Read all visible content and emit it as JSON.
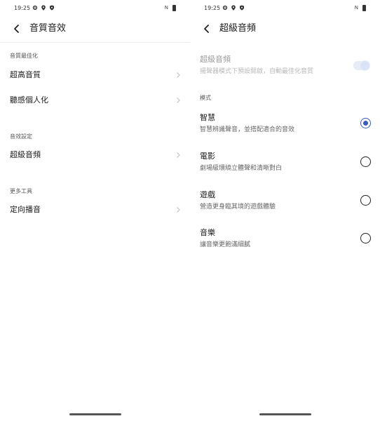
{
  "status": {
    "time": "19:25",
    "nfc": "N"
  },
  "left": {
    "title": "音質音效",
    "sections": [
      {
        "header": "音質最佳化",
        "items": [
          {
            "label": "超高音質"
          },
          {
            "label": "聽感個人化"
          }
        ]
      },
      {
        "header": "音效設定",
        "items": [
          {
            "label": "超級音頻"
          }
        ]
      },
      {
        "header": "更多工具",
        "items": [
          {
            "label": "定向播音"
          }
        ]
      }
    ]
  },
  "right": {
    "title": "超級音頻",
    "toggle_item": {
      "label": "超級音頻",
      "desc": "揚聲器模式下預設開啟，自動最佳化音質",
      "enabled": true,
      "disabled_style": true
    },
    "mode_header": "模式",
    "modes": [
      {
        "label": "智慧",
        "desc": "智慧辨識聲音，並搭配適合的音效",
        "selected": true
      },
      {
        "label": "電影",
        "desc": "劇場級環繞立體聲和清晰對白",
        "selected": false
      },
      {
        "label": "遊戲",
        "desc": "營造更身臨其境的遊戲體驗",
        "selected": false
      },
      {
        "label": "音樂",
        "desc": "讓音樂更飽滿細膩",
        "selected": false
      }
    ]
  },
  "colors": {
    "accent": "#3b5bbf",
    "section_text": "#555555",
    "disabled_text": "#9a9a9a"
  }
}
